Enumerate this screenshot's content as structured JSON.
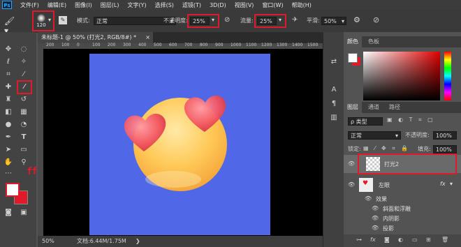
{
  "menu": {
    "logo": "Ps",
    "items": [
      "文件(F)",
      "编辑(E)",
      "图像(I)",
      "图层(L)",
      "文字(Y)",
      "选择(S)",
      "滤镜(T)",
      "3D(D)",
      "视图(V)",
      "窗口(W)",
      "帮助(H)"
    ]
  },
  "options": {
    "brush_size": "120",
    "mode_label": "模式:",
    "mode_value": "正常",
    "opacity_label": "不透明度:",
    "opacity_value": "25%",
    "flow_label": "流量:",
    "flow_value": "25%",
    "smoothing_label": "平滑:",
    "smoothing_value": "50%"
  },
  "document": {
    "tab_title": "未标题-1 @ 50% (打光2, RGB/8#) *",
    "ruler_labels": [
      "200",
      "100",
      "0",
      "100",
      "200",
      "300",
      "400",
      "500",
      "600",
      "700",
      "800",
      "900",
      "1000",
      "1100",
      "1200",
      "1300",
      "1400",
      "1500"
    ],
    "zoom": "50%",
    "doc_size": "文档:6.44M/1.75M",
    "background_color": "#5168e6"
  },
  "annotation": {
    "color_text": "ffffff"
  },
  "colors": {
    "foreground": "#ffffff",
    "background": "#e0192b",
    "highlight": "#e0192b"
  },
  "color_panel": {
    "tabs": [
      "颜色",
      "色板"
    ]
  },
  "layers_panel": {
    "tabs": [
      "图层",
      "通道",
      "路径"
    ],
    "filter_label": "ρ 类型",
    "blend_mode": "正常",
    "opacity_label": "不透明度:",
    "opacity_value": "100%",
    "lock_label": "锁定:",
    "fill_label": "填充:",
    "fill_value": "100%",
    "layers": [
      {
        "name": "打光2"
      },
      {
        "name": "左眼"
      }
    ],
    "effects_label": "效果",
    "effects": [
      "斜面和浮雕",
      "内阴影",
      "投影"
    ],
    "fx_label": "fx"
  }
}
